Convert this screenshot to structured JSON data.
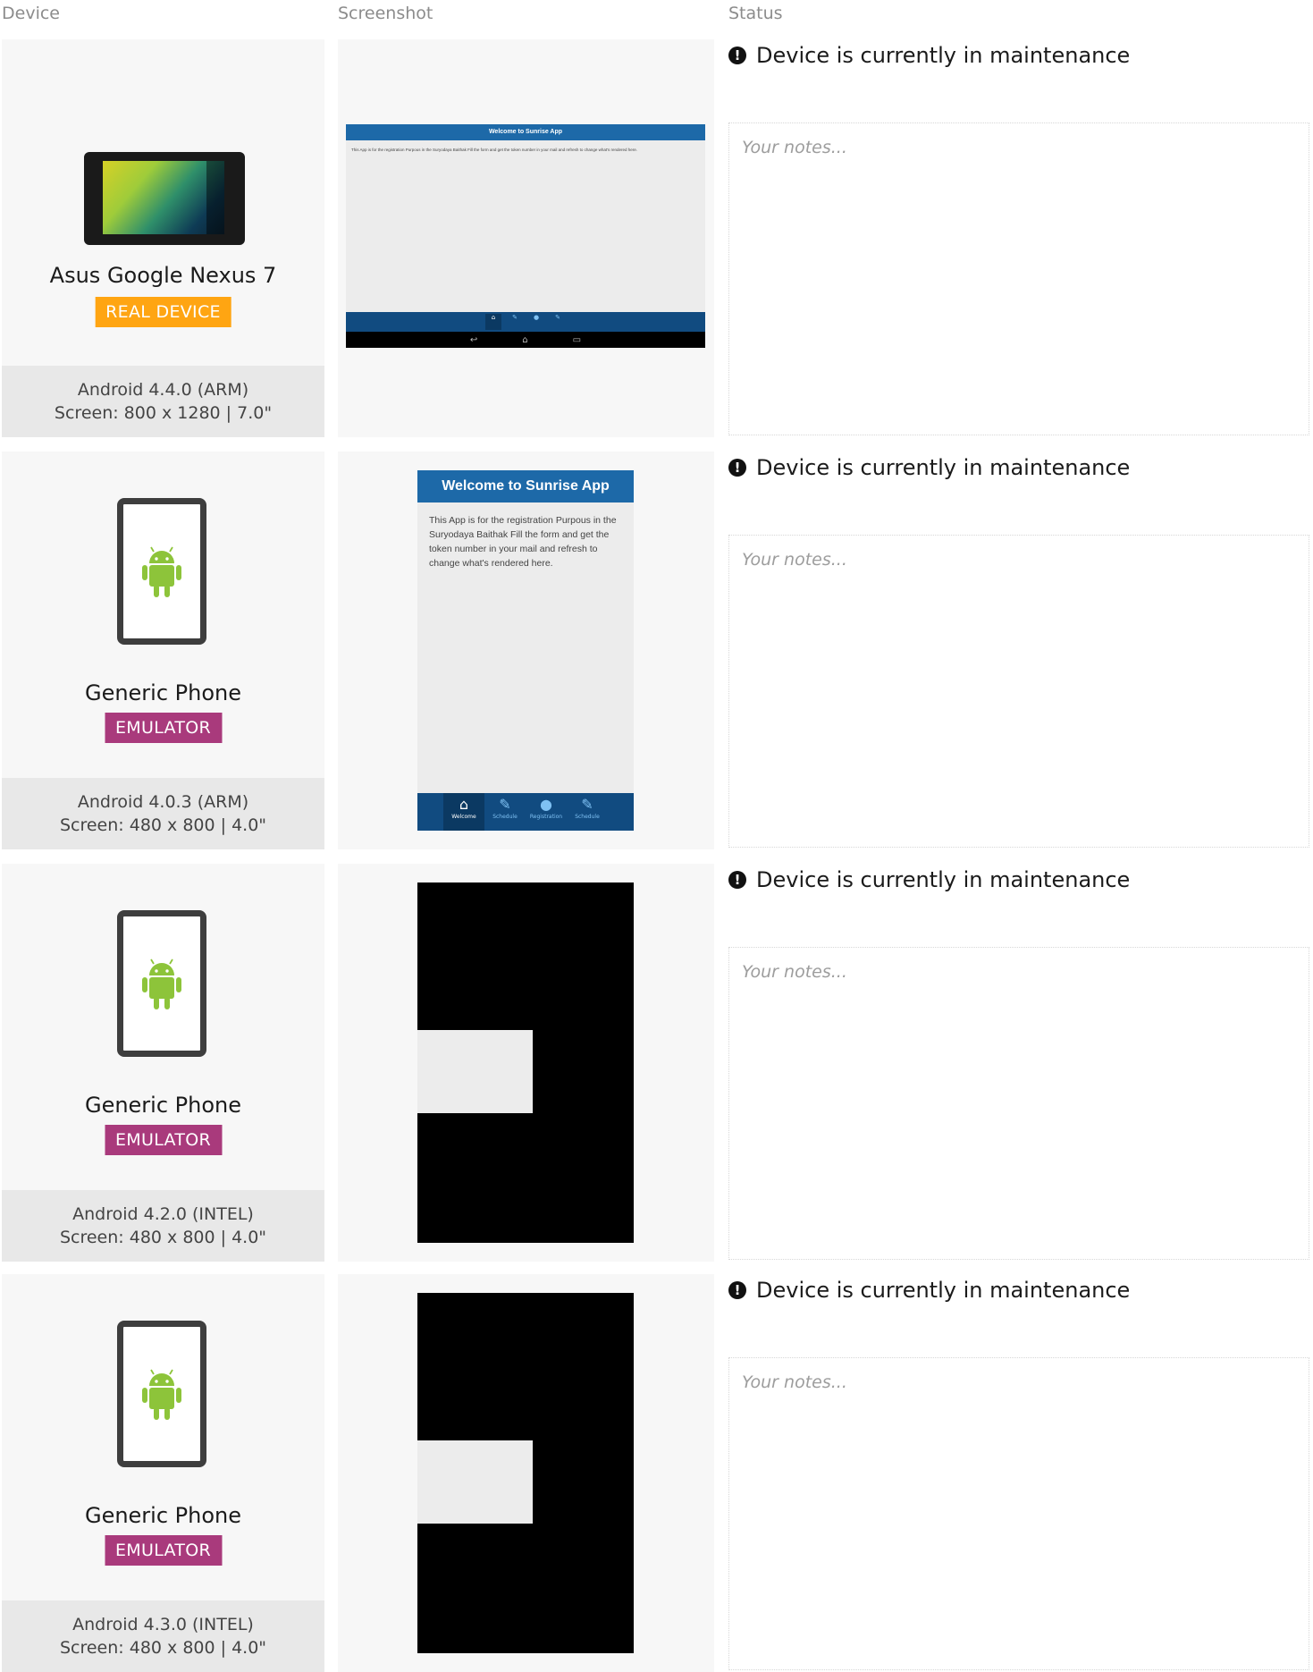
{
  "headers": {
    "device": "Device",
    "screenshot": "Screenshot",
    "status": "Status"
  },
  "rows": [
    {
      "device_name": "Asus Google Nexus 7",
      "badge": "REAL DEVICE",
      "badge_color": "#ffa512",
      "os": "Android 4.4.0 (ARM)",
      "screen": "Screen: 800 x 1280 | 7.0\"",
      "status": "Device is currently in maintenance",
      "notes_placeholder": "Your notes...",
      "screenshot": {
        "title": "Welcome to Sunrise App",
        "body": "This App is for the registration Purpous in the Suryodaya Baithak Fill the form and get the token number in your mail and refresh to change what's rendered here.",
        "nav": [
          "Welcome",
          "Schedule",
          "Registration",
          "Schedule"
        ]
      }
    },
    {
      "device_name": "Generic Phone",
      "badge": "EMULATOR",
      "badge_color": "#a93a7c",
      "os": "Android 4.0.3 (ARM)",
      "screen": "Screen: 480 x 800 | 4.0\"",
      "status": "Device is currently in maintenance",
      "notes_placeholder": "Your notes...",
      "screenshot": {
        "title": "Welcome to Sunrise App",
        "body": "This App is for the registration Purpous in the Suryodaya Baithak Fill the form and get the token number in your mail and refresh to change what's rendered here.",
        "nav": [
          "Welcome",
          "Schedule",
          "Registration",
          "Schedule"
        ]
      }
    },
    {
      "device_name": "Generic Phone",
      "badge": "EMULATOR",
      "badge_color": "#a93a7c",
      "os": "Android 4.2.0 (INTEL)",
      "screen": "Screen: 480 x 800 | 4.0\"",
      "status": "Device is currently in maintenance",
      "notes_placeholder": "Your notes..."
    },
    {
      "device_name": "Generic Phone",
      "badge": "EMULATOR",
      "badge_color": "#a93a7c",
      "os": "Android 4.3.0 (INTEL)",
      "screen": "Screen: 480 x 800 | 4.0\"",
      "status": "Device is currently in maintenance",
      "notes_placeholder": "Your notes..."
    }
  ]
}
